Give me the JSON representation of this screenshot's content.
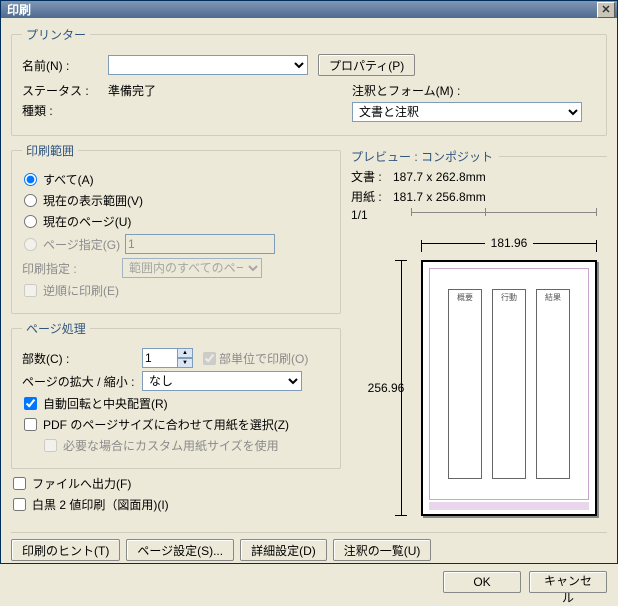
{
  "window": {
    "title": "印刷",
    "close_x": "✕"
  },
  "printer": {
    "legend": "プリンター",
    "name_label": "名前(N) :",
    "name_value": "　　　　　　　　　　　　　　",
    "properties_btn": "プロパティ(P)",
    "status_label": "ステータス :",
    "status_value": "準備完了",
    "type_label": "種類 :",
    "type_value": "　　　　　　　　　　　　　　",
    "comments_label": "注釈とフォーム(M) :",
    "comments_value": "文書と注釈"
  },
  "range": {
    "legend": "印刷範囲",
    "all": "すべて(A)",
    "current_view": "現在の表示範囲(V)",
    "current_page": "現在のページ(U)",
    "pages_label": "ページ指定(G)",
    "pages_value": "1",
    "subset_label": "印刷指定 :",
    "subset_value": "範囲内のすべてのペー",
    "reverse": "逆順に印刷(E)"
  },
  "handling": {
    "legend": "ページ処理",
    "copies_label": "部数(C) :",
    "copies_value": "1",
    "collate": "部単位で印刷(O)",
    "scaling_label": "ページの拡大 / 縮小 :",
    "scaling_value": "なし",
    "autorotate": "自動回転と中央配置(R)",
    "choose_paper": "PDF のページサイズに合わせて用紙を選択(Z)",
    "custom_paper": "必要な場合にカスタム用紙サイズを使用"
  },
  "misc": {
    "to_file": "ファイルへ出力(F)",
    "bw": "白黒 2 値印刷（図面用)(I)"
  },
  "preview": {
    "legend": "プレビュー : コンポジット",
    "doc_label": "文書 :",
    "doc_value": "187.7 x 262.8mm",
    "paper_label": "用紙 :",
    "paper_value": "181.7 x 256.8mm",
    "pagecount": "1/1",
    "width": "181.96",
    "height": "256.96",
    "col_headers": [
      "概要",
      "行動",
      "結果"
    ]
  },
  "buttons": {
    "tips": "印刷のヒント(T)",
    "page_setup": "ページ設定(S)...",
    "advanced": "詳細設定(D)",
    "summarize": "注釈の一覧(U)",
    "ok": "OK",
    "cancel": "キャンセル"
  }
}
